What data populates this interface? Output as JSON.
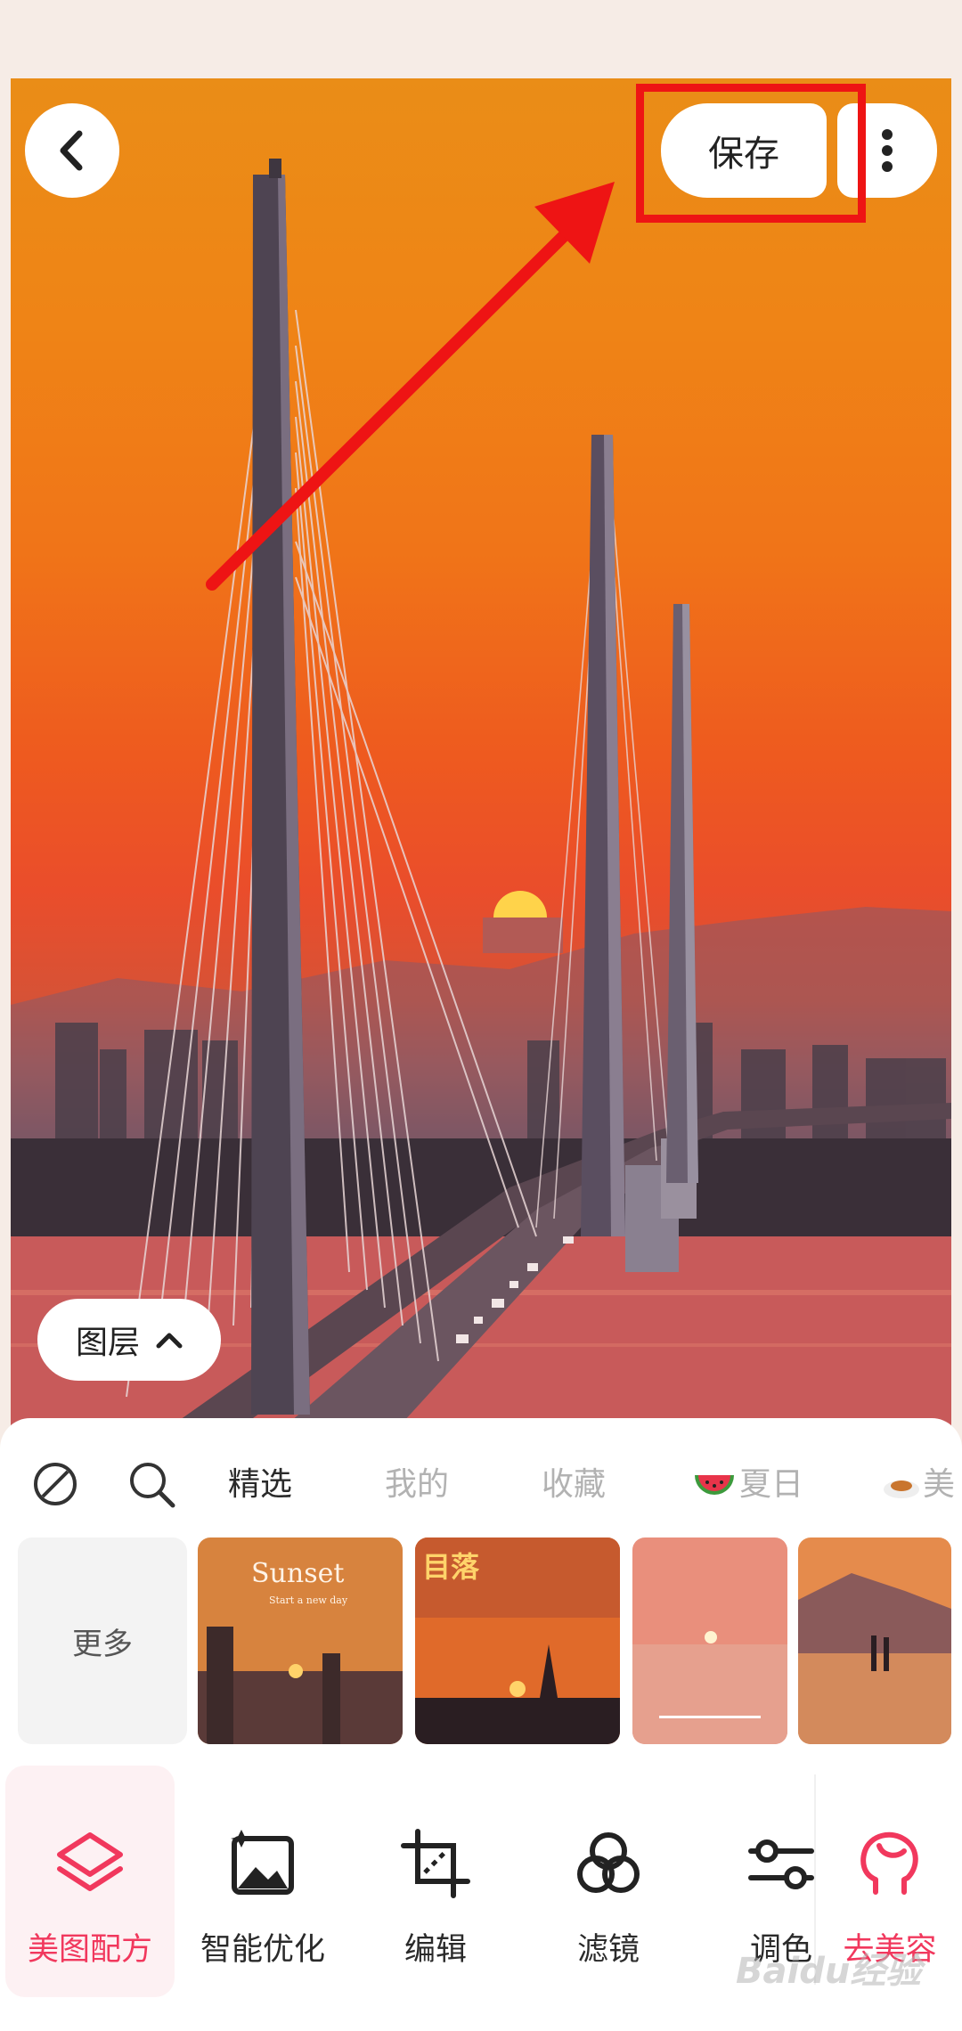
{
  "header": {
    "save_label": "保存"
  },
  "photo": {
    "layer_label": "图层"
  },
  "tabs": [
    {
      "label": "精选",
      "active": true
    },
    {
      "label": "我的",
      "active": false
    },
    {
      "label": "收藏",
      "active": false
    },
    {
      "label": "夏日",
      "active": false
    },
    {
      "label": "美",
      "active": false
    }
  ],
  "thumbnails": {
    "more_label": "更多",
    "items": [
      {
        "title": "Sunset",
        "subtitle": "Start a new day"
      },
      {
        "title": "目落",
        "subtitle": ""
      },
      {
        "title": "",
        "subtitle": ""
      },
      {
        "title": "",
        "subtitle": ""
      }
    ]
  },
  "toolbar": [
    {
      "label": "美图配方",
      "icon": "layers-icon",
      "active": true
    },
    {
      "label": "智能优化",
      "icon": "smart-enhance-icon",
      "active": false
    },
    {
      "label": "编辑",
      "icon": "crop-icon",
      "active": false
    },
    {
      "label": "滤镜",
      "icon": "filter-circles-icon",
      "active": false
    },
    {
      "label": "调色",
      "icon": "adjust-sliders-icon",
      "active": false
    },
    {
      "label": "去美容",
      "icon": "beauty-face-icon",
      "active": false
    }
  ],
  "watermark": "Baidu经验",
  "colors": {
    "accent": "#f1385d",
    "highlight": "#ee1414",
    "background": "#f6ece6"
  }
}
